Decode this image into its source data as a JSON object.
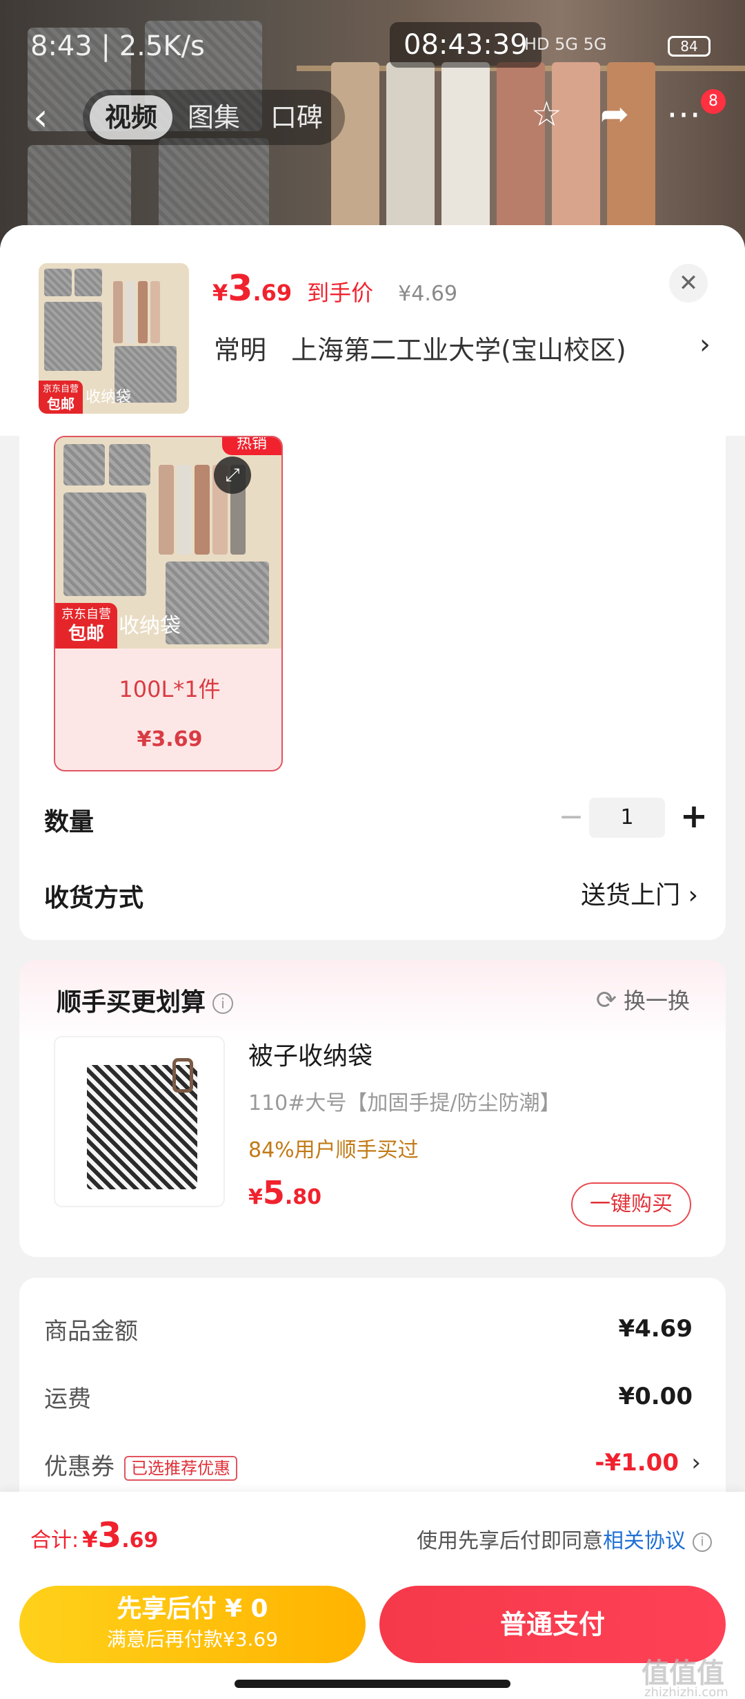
{
  "status_bar": {
    "left_text": "8:43 | 2.5K/s",
    "time_pill": "08:43:39",
    "network": "HD 5G 5G",
    "battery": "84"
  },
  "nav": {
    "tabs": [
      {
        "label": "视频",
        "active": true
      },
      {
        "label": "图集",
        "active": false
      },
      {
        "label": "口碑",
        "active": false
      }
    ],
    "badge_count": "8"
  },
  "product": {
    "price_symbol": "¥",
    "price_int": "3",
    "price_dec": ".69",
    "price_label": "到手价",
    "original_price": "¥4.69",
    "thumb_tag_line1": "京东自营",
    "thumb_tag_line2": "包邮",
    "thumb_caption": "收纳袋",
    "address_name": "常明",
    "address": "上海第二工业大学(宝山校区)"
  },
  "spec": {
    "hot_tag": "热销",
    "jd_line1": "京东自营",
    "jd_line2": "包邮",
    "image_caption": "收纳袋",
    "option_name": "100L*1件",
    "option_price": "¥3.69",
    "quantity_label": "数量",
    "quantity_value": "1",
    "minus": "−",
    "plus": "+",
    "delivery_label": "收货方式",
    "delivery_value": "送货上门"
  },
  "upsell": {
    "title": "顺手买更划算",
    "swap_label": "换一换",
    "item_name": "被子收纳袋",
    "item_spec": "110#大号【加固手提/防尘防潮】",
    "bought_text": "84%用户顺手买过",
    "price_symbol": "¥",
    "price_int": "5",
    "price_dec": ".80",
    "buy_label": "一键购买"
  },
  "summary": {
    "goods_label": "商品金额",
    "goods_value": "¥4.69",
    "shipping_label": "运费",
    "shipping_value": "¥0.00",
    "coupon_label": "优惠券",
    "coupon_tag": "已选推荐优惠",
    "coupon_value": "-¥1.00"
  },
  "bottom": {
    "total_label": "合计:",
    "total_symbol": "¥",
    "total_int": "3",
    "total_dec": ".69",
    "agree_text": "使用先享后付即同意",
    "agree_link": "相关协议",
    "pay_later_line1": "先享后付 ¥ 0",
    "pay_later_line2": "满意后再付款¥3.69",
    "pay_normal": "普通支付",
    "watermark": "值值值",
    "watermark_sub": "zhizhizhi.com"
  },
  "colors": {
    "accent_red": "#f0222e",
    "pay_later_yellow": "#ffc107",
    "link_blue": "#1f6fd6",
    "bought_orange": "#c27a16"
  }
}
